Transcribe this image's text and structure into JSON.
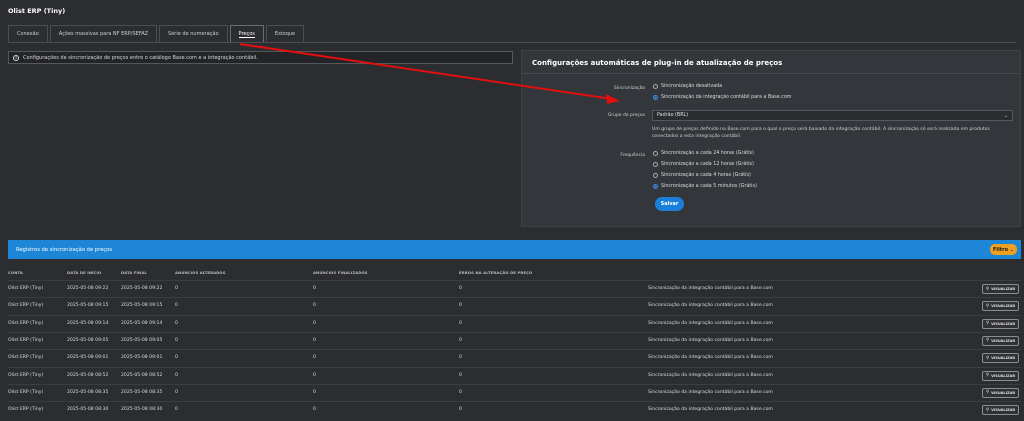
{
  "app": {
    "title": "Olist ERP (Tiny)"
  },
  "tabs": [
    {
      "label": "Conexão",
      "active": false
    },
    {
      "label": "Ações massivas para NF ERP/SEFAZ",
      "active": false
    },
    {
      "label": "Série de numeração",
      "active": false
    },
    {
      "label": "Preços",
      "active": true
    },
    {
      "label": "Estoque",
      "active": false
    }
  ],
  "info": {
    "icon": "info-icon",
    "text": "Configurações de sincronização de preços entre o catálogo Base.com e a integração contábil."
  },
  "config": {
    "title": "Configurações automáticas de plug-in de atualização de preços",
    "sync_label": "Sincronização",
    "sync_options": [
      {
        "label": "Sincronização desativada",
        "checked": false
      },
      {
        "label": "Sincronização da integração contábil para a Base.com",
        "checked": true
      }
    ],
    "group_label": "Grupo de preços",
    "group_value": "Padrão (BRL)",
    "help_text": "Um grupo de preços definido na Base.com para o qual o preço será baixado da integração contábil. A sincronização só será realizada em produtos conectados a esta integração contábil.",
    "freq_label": "Frequência",
    "freq_options": [
      {
        "label": "Sincronização a cada 24 horas (Grátis)",
        "checked": false
      },
      {
        "label": "Sincronização a cada 12 horas (Grátis)",
        "checked": false
      },
      {
        "label": "Sincronização a cada 4 horas (Grátis)",
        "checked": false
      },
      {
        "label": "Sincronização a cada 5 minutos (Grátis)",
        "checked": true
      }
    ],
    "save_label": "Salvar"
  },
  "log": {
    "title": "Registros de sincronização de preços",
    "filter_label": "Filtro ⌄",
    "columns": [
      "CONTA",
      "DATA DE INÍCIO",
      "DATA FINAL",
      "ANÚNCIOS ALTERADOS",
      "ANÚNCIOS FINALIZADOS",
      "ERROS NA ALTERAÇÃO DE PREÇO"
    ],
    "view_label": "VISUALIZAR",
    "rows": [
      {
        "account": "Olist ERP (Tiny)",
        "start": "2025-05-08 09:22",
        "end": "2025-05-08 09:22",
        "changed": "0",
        "finished": "0",
        "errors": "0",
        "desc": "Sincronização da integração contábil para a Base.com"
      },
      {
        "account": "Olist ERP (Tiny)",
        "start": "2025-05-08 09:15",
        "end": "2025-05-08 09:15",
        "changed": "0",
        "finished": "0",
        "errors": "0",
        "desc": "Sincronização da integração contábil para a Base.com"
      },
      {
        "account": "Olist ERP (Tiny)",
        "start": "2025-05-08 09:14",
        "end": "2025-05-08 09:14",
        "changed": "0",
        "finished": "0",
        "errors": "0",
        "desc": "Sincronização da integração contábil para a Base.com"
      },
      {
        "account": "Olist ERP (Tiny)",
        "start": "2025-05-08 09:05",
        "end": "2025-05-08 09:05",
        "changed": "0",
        "finished": "0",
        "errors": "0",
        "desc": "Sincronização da integração contábil para a Base.com"
      },
      {
        "account": "Olist ERP (Tiny)",
        "start": "2025-05-08 09:01",
        "end": "2025-05-08 09:01",
        "changed": "0",
        "finished": "0",
        "errors": "0",
        "desc": "Sincronização da integração contábil para a Base.com"
      },
      {
        "account": "Olist ERP (Tiny)",
        "start": "2025-05-08 08:52",
        "end": "2025-05-08 08:52",
        "changed": "0",
        "finished": "0",
        "errors": "0",
        "desc": "Sincronização da integração contábil para a Base.com"
      },
      {
        "account": "Olist ERP (Tiny)",
        "start": "2025-05-08 08:35",
        "end": "2025-05-08 08:35",
        "changed": "0",
        "finished": "0",
        "errors": "0",
        "desc": "Sincronização da integração contábil para a Base.com"
      },
      {
        "account": "Olist ERP (Tiny)",
        "start": "2025-05-08 08:30",
        "end": "2025-05-08 08:30",
        "changed": "0",
        "finished": "0",
        "errors": "0",
        "desc": "Sincronização da integração contábil para a Base.com"
      }
    ]
  },
  "colors": {
    "accent": "#1d86d6",
    "filter": "#f0a020",
    "annotation": "#e01010"
  }
}
